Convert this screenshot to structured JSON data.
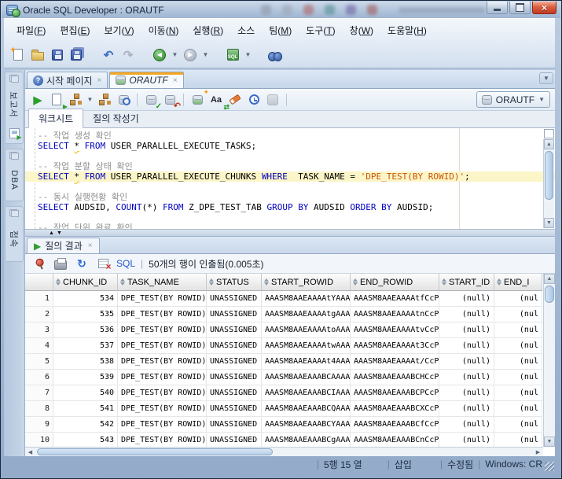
{
  "window": {
    "title": "Oracle SQL Developer : ORAUTF"
  },
  "menus": [
    "파일(F)",
    "편집(E)",
    "보기(V)",
    "이동(N)",
    "실행(R)",
    "소스",
    "팀(M)",
    "도구(T)",
    "창(W)",
    "도움말(H)"
  ],
  "doc_tabs": [
    "시작 페이지",
    "ORAUTF"
  ],
  "side_tabs": [
    "보고서",
    "DBA",
    "접속"
  ],
  "worksheet_tabs": [
    "워크시트",
    "질의 작성기"
  ],
  "connection": "ORAUTF",
  "editor": {
    "lines": [
      {
        "hl": false,
        "seg": [
          {
            "c": "com",
            "t": "-- 작업 생성 확인"
          }
        ]
      },
      {
        "hl": false,
        "seg": [
          {
            "c": "kw",
            "t": "SELECT"
          },
          {
            "c": "pl",
            "t": " "
          },
          {
            "c": "star",
            "t": "*"
          },
          {
            "c": "pl",
            "t": " "
          },
          {
            "c": "kw",
            "t": "FROM"
          },
          {
            "c": "pl",
            "t": " USER_PARALLEL_EXECUTE_TASKS;"
          }
        ]
      },
      {
        "hl": false,
        "seg": []
      },
      {
        "hl": false,
        "seg": [
          {
            "c": "com",
            "t": "-- 작업 분할 상태 확인"
          }
        ]
      },
      {
        "hl": true,
        "seg": [
          {
            "c": "kw",
            "t": "SELECT"
          },
          {
            "c": "pl",
            "t": " "
          },
          {
            "c": "star",
            "t": "*"
          },
          {
            "c": "pl",
            "t": " "
          },
          {
            "c": "kw",
            "t": "FROM"
          },
          {
            "c": "pl",
            "t": " USER_PARALLEL_EXECUTE_CHUNKS "
          },
          {
            "c": "kw",
            "t": "WHERE"
          },
          {
            "c": "pl",
            "t": "  TASK_NAME = "
          },
          {
            "c": "str",
            "t": "'DPE_TEST(BY ROWID)'"
          },
          {
            "c": "pl",
            "t": ";"
          }
        ]
      },
      {
        "hl": false,
        "seg": []
      },
      {
        "hl": false,
        "seg": [
          {
            "c": "com",
            "t": "-- 동시 실행현황 확인"
          }
        ]
      },
      {
        "hl": false,
        "seg": [
          {
            "c": "kw",
            "t": "SELECT"
          },
          {
            "c": "pl",
            "t": " AUDSID, "
          },
          {
            "c": "kw",
            "t": "COUNT"
          },
          {
            "c": "pl",
            "t": "(*) "
          },
          {
            "c": "kw",
            "t": "FROM"
          },
          {
            "c": "pl",
            "t": " Z_DPE_TEST_TAB "
          },
          {
            "c": "kw",
            "t": "GROUP BY"
          },
          {
            "c": "pl",
            "t": " AUDSID "
          },
          {
            "c": "kw",
            "t": "ORDER BY"
          },
          {
            "c": "pl",
            "t": " AUDSID;"
          }
        ]
      },
      {
        "hl": false,
        "seg": []
      },
      {
        "hl": false,
        "seg": [
          {
            "c": "com",
            "t": "-- 작업 단위 완료 확인"
          }
        ]
      }
    ]
  },
  "results": {
    "tab_label": "질의 결과",
    "sql_link": "SQL",
    "fetch_status": "50개의 행이 인출됨(0.005초)",
    "grid": {
      "columns": [
        {
          "label": "",
          "align": "right"
        },
        {
          "label": "CHUNK_ID",
          "align": "right"
        },
        {
          "label": "TASK_NAME",
          "align": "left"
        },
        {
          "label": "STATUS",
          "align": "left"
        },
        {
          "label": "START_ROWID",
          "align": "left"
        },
        {
          "label": "END_ROWID",
          "align": "left"
        },
        {
          "label": "START_ID",
          "align": "right"
        },
        {
          "label": "END_I",
          "align": "right"
        }
      ],
      "rows": [
        [
          "1",
          "534",
          "DPE_TEST(BY ROWID)",
          "UNASSIGNED",
          "AAASM8AAEAAAAtYAAA",
          "AAASM8AAEAAAAtfCcP",
          "(null)",
          "(nul"
        ],
        [
          "2",
          "535",
          "DPE_TEST(BY ROWID)",
          "UNASSIGNED",
          "AAASM8AAEAAAAtgAAA",
          "AAASM8AAEAAAAtnCcP",
          "(null)",
          "(nul"
        ],
        [
          "3",
          "536",
          "DPE_TEST(BY ROWID)",
          "UNASSIGNED",
          "AAASM8AAEAAAAtoAAA",
          "AAASM8AAEAAAAtvCcP",
          "(null)",
          "(nul"
        ],
        [
          "4",
          "537",
          "DPE_TEST(BY ROWID)",
          "UNASSIGNED",
          "AAASM8AAEAAAAtwAAA",
          "AAASM8AAEAAAAt3CcP",
          "(null)",
          "(nul"
        ],
        [
          "5",
          "538",
          "DPE_TEST(BY ROWID)",
          "UNASSIGNED",
          "AAASM8AAEAAAAt4AAA",
          "AAASM8AAEAAAAt/CcP",
          "(null)",
          "(nul"
        ],
        [
          "6",
          "539",
          "DPE_TEST(BY ROWID)",
          "UNASSIGNED",
          "AAASM8AAEAAABCAAAA",
          "AAASM8AAEAAABCHCcP",
          "(null)",
          "(nul"
        ],
        [
          "7",
          "540",
          "DPE_TEST(BY ROWID)",
          "UNASSIGNED",
          "AAASM8AAEAAABCIAAA",
          "AAASM8AAEAAABCPCcP",
          "(null)",
          "(nul"
        ],
        [
          "8",
          "541",
          "DPE_TEST(BY ROWID)",
          "UNASSIGNED",
          "AAASM8AAEAAABCQAAA",
          "AAASM8AAEAAABCXCcP",
          "(null)",
          "(nul"
        ],
        [
          "9",
          "542",
          "DPE_TEST(BY ROWID)",
          "UNASSIGNED",
          "AAASM8AAEAAABCYAAA",
          "AAASM8AAEAAABCfCcP",
          "(null)",
          "(nul"
        ],
        [
          "10",
          "543",
          "DPE_TEST(BY ROWID)",
          "UNASSIGNED",
          "AAASM8AAEAAABCgAAA",
          "AAASM8AAEAAABCnCcP",
          "(null)",
          "(nul"
        ]
      ]
    }
  },
  "statusbar": {
    "position": "5행 15 열",
    "insert_mode": "삽입",
    "modified": "수정됨",
    "line_ending": "Windows: CR"
  },
  "colors": {
    "accent_orange": "#f5a623",
    "keyword_blue": "#0000c0",
    "comment_gray": "#8e8e8e",
    "string_orange": "#cc5500",
    "run_green": "#2f9e2f",
    "close_red": "#c03a22"
  }
}
